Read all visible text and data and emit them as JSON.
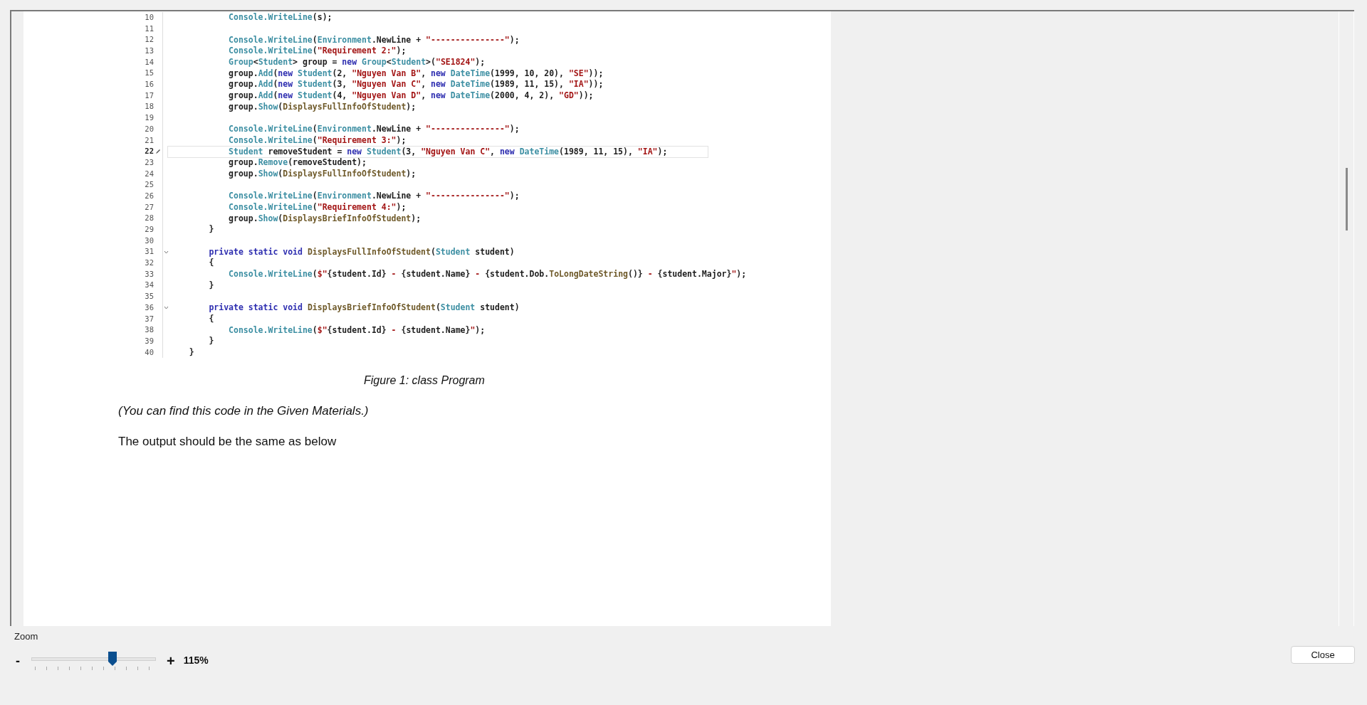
{
  "document": {
    "code_lines": [
      {
        "number": "10",
        "current": false,
        "fold": false,
        "segs": [
          {
            "text": "            Console.WriteLine",
            "kind": "type"
          },
          {
            "text": "(s);",
            "kind": "plain"
          }
        ]
      },
      {
        "number": "11",
        "current": false,
        "fold": false
      },
      {
        "number": "12",
        "current": false,
        "fold": false,
        "segs": [
          {
            "text": "            Console.WriteLine",
            "kind": "type"
          },
          {
            "text": "(",
            "kind": "plain"
          },
          {
            "text": "Environment",
            "kind": "type"
          },
          {
            "text": ".NewLine + ",
            "kind": "plain"
          },
          {
            "text": "\"---------------\"",
            "kind": "string"
          },
          {
            "text": ");",
            "kind": "plain"
          }
        ]
      },
      {
        "number": "13",
        "current": false,
        "fold": false,
        "segs": [
          {
            "text": "            Console.WriteLine",
            "kind": "type"
          },
          {
            "text": "(",
            "kind": "plain"
          },
          {
            "text": "\"Requirement 2:\"",
            "kind": "string"
          },
          {
            "text": ");",
            "kind": "plain"
          }
        ]
      },
      {
        "number": "14",
        "current": false,
        "fold": false,
        "segs": [
          {
            "text": "            Group",
            "kind": "type"
          },
          {
            "text": "<",
            "kind": "plain"
          },
          {
            "text": "Student",
            "kind": "type"
          },
          {
            "text": "> group = ",
            "kind": "plain"
          },
          {
            "text": "new ",
            "kind": "keyword"
          },
          {
            "text": "Group",
            "kind": "type"
          },
          {
            "text": "<",
            "kind": "plain"
          },
          {
            "text": "Student",
            "kind": "type"
          },
          {
            "text": ">(",
            "kind": "plain"
          },
          {
            "text": "\"SE1824\"",
            "kind": "string"
          },
          {
            "text": ");",
            "kind": "plain"
          }
        ]
      },
      {
        "number": "15",
        "current": false,
        "fold": false,
        "segs": [
          {
            "text": "            group.",
            "kind": "plain"
          },
          {
            "text": "Add",
            "kind": "type"
          },
          {
            "text": "(",
            "kind": "plain"
          },
          {
            "text": "new ",
            "kind": "keyword"
          },
          {
            "text": "Student",
            "kind": "type"
          },
          {
            "text": "(2, ",
            "kind": "plain"
          },
          {
            "text": "\"Nguyen Van B\"",
            "kind": "string"
          },
          {
            "text": ", ",
            "kind": "plain"
          },
          {
            "text": "new ",
            "kind": "keyword"
          },
          {
            "text": "DateTime",
            "kind": "type"
          },
          {
            "text": "(1999, 10, 20), ",
            "kind": "plain"
          },
          {
            "text": "\"SE\"",
            "kind": "string"
          },
          {
            "text": "));",
            "kind": "plain"
          }
        ]
      },
      {
        "number": "16",
        "current": false,
        "fold": false,
        "segs": [
          {
            "text": "            group.",
            "kind": "plain"
          },
          {
            "text": "Add",
            "kind": "type"
          },
          {
            "text": "(",
            "kind": "plain"
          },
          {
            "text": "new ",
            "kind": "keyword"
          },
          {
            "text": "Student",
            "kind": "type"
          },
          {
            "text": "(3, ",
            "kind": "plain"
          },
          {
            "text": "\"Nguyen Van C\"",
            "kind": "string"
          },
          {
            "text": ", ",
            "kind": "plain"
          },
          {
            "text": "new ",
            "kind": "keyword"
          },
          {
            "text": "DateTime",
            "kind": "type"
          },
          {
            "text": "(1989, 11, 15), ",
            "kind": "plain"
          },
          {
            "text": "\"IA\"",
            "kind": "string"
          },
          {
            "text": "));",
            "kind": "plain"
          }
        ]
      },
      {
        "number": "17",
        "current": false,
        "fold": false,
        "segs": [
          {
            "text": "            group.",
            "kind": "plain"
          },
          {
            "text": "Add",
            "kind": "type"
          },
          {
            "text": "(",
            "kind": "plain"
          },
          {
            "text": "new ",
            "kind": "keyword"
          },
          {
            "text": "Student",
            "kind": "type"
          },
          {
            "text": "(4, ",
            "kind": "plain"
          },
          {
            "text": "\"Nguyen Van D\"",
            "kind": "string"
          },
          {
            "text": ", ",
            "kind": "plain"
          },
          {
            "text": "new ",
            "kind": "keyword"
          },
          {
            "text": "DateTime",
            "kind": "type"
          },
          {
            "text": "(2000, 4, 2), ",
            "kind": "plain"
          },
          {
            "text": "\"GD\"",
            "kind": "string"
          },
          {
            "text": "));",
            "kind": "plain"
          }
        ]
      },
      {
        "number": "18",
        "current": false,
        "fold": false,
        "segs": [
          {
            "text": "            group.",
            "kind": "plain"
          },
          {
            "text": "Show",
            "kind": "type"
          },
          {
            "text": "(",
            "kind": "plain"
          },
          {
            "text": "DisplaysFullInfoOfStudent",
            "kind": "method"
          },
          {
            "text": ");",
            "kind": "plain"
          }
        ]
      },
      {
        "number": "19",
        "current": false,
        "fold": false
      },
      {
        "number": "20",
        "current": false,
        "fold": false,
        "segs": [
          {
            "text": "            Console.WriteLine",
            "kind": "type"
          },
          {
            "text": "(",
            "kind": "plain"
          },
          {
            "text": "Environment",
            "kind": "type"
          },
          {
            "text": ".NewLine + ",
            "kind": "plain"
          },
          {
            "text": "\"---------------\"",
            "kind": "string"
          },
          {
            "text": ");",
            "kind": "plain"
          }
        ]
      },
      {
        "number": "21",
        "current": false,
        "fold": false,
        "segs": [
          {
            "text": "            Console.WriteLine",
            "kind": "type"
          },
          {
            "text": "(",
            "kind": "plain"
          },
          {
            "text": "\"Requirement 3:\"",
            "kind": "string"
          },
          {
            "text": ");",
            "kind": "plain"
          }
        ]
      },
      {
        "number": "22",
        "current": true,
        "fold": false,
        "segs": [
          {
            "text": "            Student",
            "kind": "type"
          },
          {
            "text": " removeStudent = ",
            "kind": "plain"
          },
          {
            "text": "new ",
            "kind": "keyword"
          },
          {
            "text": "Student",
            "kind": "type"
          },
          {
            "text": "(3, ",
            "kind": "plain"
          },
          {
            "text": "\"Nguyen Van C\"",
            "kind": "string"
          },
          {
            "text": ", ",
            "kind": "plain"
          },
          {
            "text": "new ",
            "kind": "keyword"
          },
          {
            "text": "DateTime",
            "kind": "type"
          },
          {
            "text": "(1989, 11, 15), ",
            "kind": "plain"
          },
          {
            "text": "\"IA\"",
            "kind": "string"
          },
          {
            "text": ");",
            "kind": "plain"
          }
        ]
      },
      {
        "number": "23",
        "current": false,
        "fold": false,
        "segs": [
          {
            "text": "            group.",
            "kind": "plain"
          },
          {
            "text": "Remove",
            "kind": "type"
          },
          {
            "text": "(removeStudent);",
            "kind": "plain"
          }
        ]
      },
      {
        "number": "24",
        "current": false,
        "fold": false,
        "segs": [
          {
            "text": "            group.",
            "kind": "plain"
          },
          {
            "text": "Show",
            "kind": "type"
          },
          {
            "text": "(",
            "kind": "plain"
          },
          {
            "text": "DisplaysFullInfoOfStudent",
            "kind": "method"
          },
          {
            "text": ");",
            "kind": "plain"
          }
        ]
      },
      {
        "number": "25",
        "current": false,
        "fold": false
      },
      {
        "number": "26",
        "current": false,
        "fold": false,
        "segs": [
          {
            "text": "            Console.WriteLine",
            "kind": "type"
          },
          {
            "text": "(",
            "kind": "plain"
          },
          {
            "text": "Environment",
            "kind": "type"
          },
          {
            "text": ".NewLine + ",
            "kind": "plain"
          },
          {
            "text": "\"---------------\"",
            "kind": "string"
          },
          {
            "text": ");",
            "kind": "plain"
          }
        ]
      },
      {
        "number": "27",
        "current": false,
        "fold": false,
        "segs": [
          {
            "text": "            Console.WriteLine",
            "kind": "type"
          },
          {
            "text": "(",
            "kind": "plain"
          },
          {
            "text": "\"Requirement 4:\"",
            "kind": "string"
          },
          {
            "text": ");",
            "kind": "plain"
          }
        ]
      },
      {
        "number": "28",
        "current": false,
        "fold": false,
        "segs": [
          {
            "text": "            group.",
            "kind": "plain"
          },
          {
            "text": "Show",
            "kind": "type"
          },
          {
            "text": "(",
            "kind": "plain"
          },
          {
            "text": "DisplaysBriefInfoOfStudent",
            "kind": "method"
          },
          {
            "text": ");",
            "kind": "plain"
          }
        ]
      },
      {
        "number": "29",
        "current": false,
        "fold": false,
        "segs": [
          {
            "text": "        }",
            "kind": "plain"
          }
        ]
      },
      {
        "number": "30",
        "current": false,
        "fold": false
      },
      {
        "number": "31",
        "current": false,
        "fold": true,
        "segs": [
          {
            "text": "        private static void ",
            "kind": "keyword"
          },
          {
            "text": "DisplaysFullInfoOfStudent",
            "kind": "method"
          },
          {
            "text": "(",
            "kind": "plain"
          },
          {
            "text": "Student",
            "kind": "type"
          },
          {
            "text": " student)",
            "kind": "plain"
          }
        ]
      },
      {
        "number": "32",
        "current": false,
        "fold": false,
        "segs": [
          {
            "text": "        {",
            "kind": "plain"
          }
        ]
      },
      {
        "number": "33",
        "current": false,
        "fold": false,
        "segs": [
          {
            "text": "            Console.WriteLine",
            "kind": "type"
          },
          {
            "text": "(",
            "kind": "plain"
          },
          {
            "text": "$\"",
            "kind": "string"
          },
          {
            "text": "{student.Id}",
            "kind": "plain"
          },
          {
            "text": " - ",
            "kind": "string"
          },
          {
            "text": "{student.Name}",
            "kind": "plain"
          },
          {
            "text": " - ",
            "kind": "string"
          },
          {
            "text": "{student.Dob.",
            "kind": "plain"
          },
          {
            "text": "ToLongDateString",
            "kind": "method"
          },
          {
            "text": "()}",
            "kind": "plain"
          },
          {
            "text": " - ",
            "kind": "string"
          },
          {
            "text": "{student.Major}",
            "kind": "plain"
          },
          {
            "text": "\"",
            "kind": "string"
          },
          {
            "text": ");",
            "kind": "plain"
          }
        ]
      },
      {
        "number": "34",
        "current": false,
        "fold": false,
        "segs": [
          {
            "text": "        }",
            "kind": "plain"
          }
        ]
      },
      {
        "number": "35",
        "current": false,
        "fold": false
      },
      {
        "number": "36",
        "current": false,
        "fold": true,
        "segs": [
          {
            "text": "        private static void ",
            "kind": "keyword"
          },
          {
            "text": "DisplaysBriefInfoOfStudent",
            "kind": "method"
          },
          {
            "text": "(",
            "kind": "plain"
          },
          {
            "text": "Student",
            "kind": "type"
          },
          {
            "text": " student)",
            "kind": "plain"
          }
        ]
      },
      {
        "number": "37",
        "current": false,
        "fold": false,
        "segs": [
          {
            "text": "        {",
            "kind": "plain"
          }
        ]
      },
      {
        "number": "38",
        "current": false,
        "fold": false,
        "segs": [
          {
            "text": "            Console.WriteLine",
            "kind": "type"
          },
          {
            "text": "(",
            "kind": "plain"
          },
          {
            "text": "$\"",
            "kind": "string"
          },
          {
            "text": "{student.Id}",
            "kind": "plain"
          },
          {
            "text": " - ",
            "kind": "string"
          },
          {
            "text": "{student.Name}",
            "kind": "plain"
          },
          {
            "text": "\"",
            "kind": "string"
          },
          {
            "text": ");",
            "kind": "plain"
          }
        ]
      },
      {
        "number": "39",
        "current": false,
        "fold": false,
        "segs": [
          {
            "text": "        }",
            "kind": "plain"
          }
        ]
      },
      {
        "number": "40",
        "current": false,
        "fold": false,
        "segs": [
          {
            "text": "    }",
            "kind": "plain"
          }
        ]
      }
    ],
    "caption": "Figure 1: class Program",
    "note": "(You can find this code in the Given Materials.)",
    "paragraph": "The output should be the same as below"
  },
  "zoom": {
    "label": "Zoom",
    "minus": "-",
    "plus": "+",
    "level": 0.65,
    "reading": "115%"
  },
  "close_button": "Close"
}
